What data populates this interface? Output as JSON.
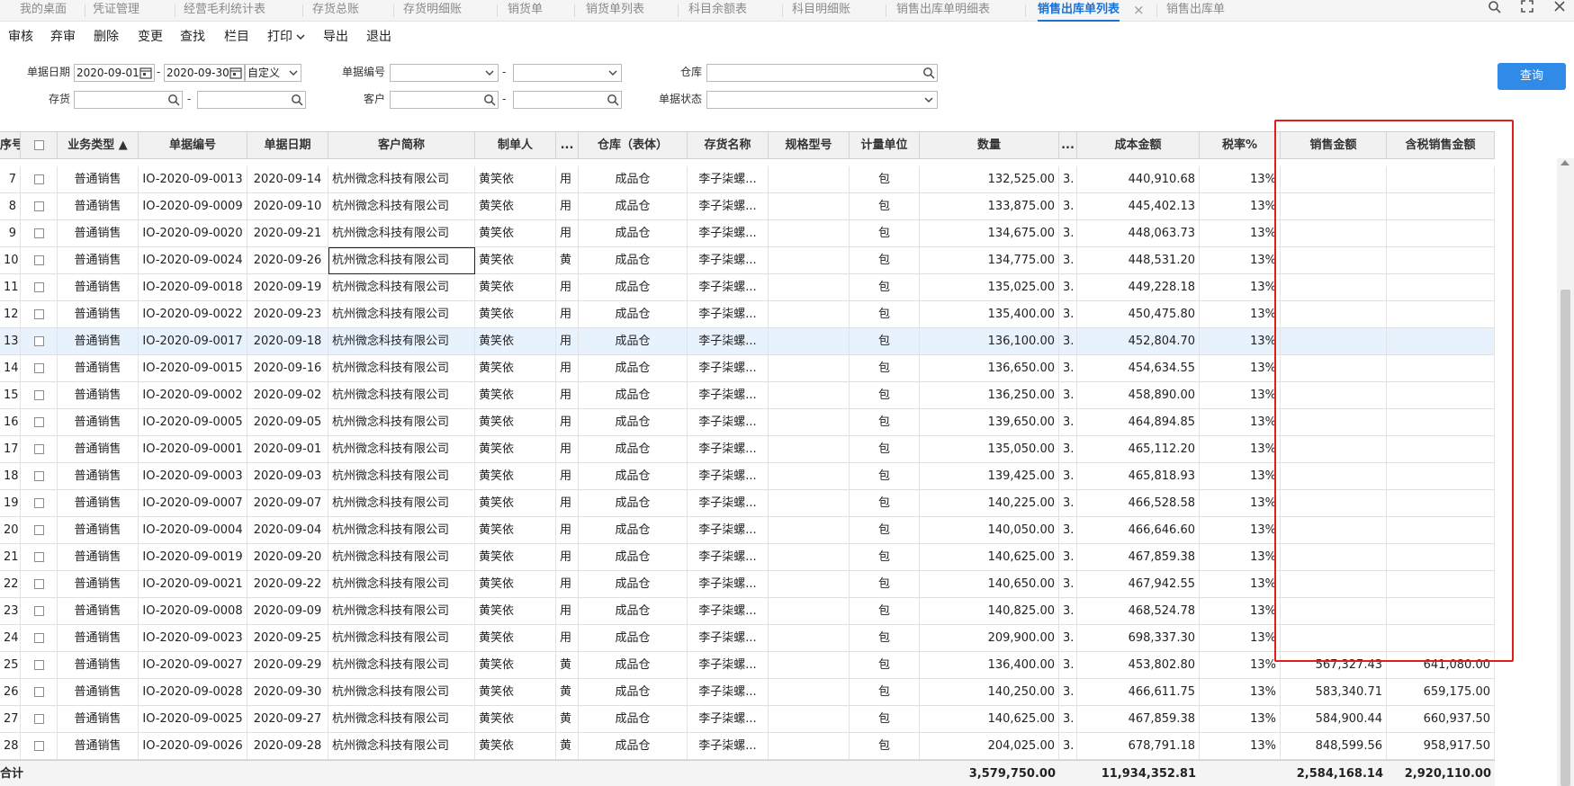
{
  "tabs": [
    {
      "label": "我的桌面",
      "active": false
    },
    {
      "label": "凭证管理",
      "active": false
    },
    {
      "label": "经营毛利统计表",
      "active": false
    },
    {
      "label": "存货总账",
      "active": false
    },
    {
      "label": "存货明细账",
      "active": false
    },
    {
      "label": "销货单",
      "active": false
    },
    {
      "label": "销货单列表",
      "active": false
    },
    {
      "label": "科目余额表",
      "active": false
    },
    {
      "label": "科目明细账",
      "active": false
    },
    {
      "label": "销售出库单明细表",
      "active": false
    },
    {
      "label": "销售出库单列表",
      "active": true
    },
    {
      "label": "销售出库单",
      "active": false
    }
  ],
  "toolbar": {
    "audit": "审核",
    "unaudit": "弃审",
    "delete": "删除",
    "change": "变更",
    "find": "查找",
    "columns": "栏目",
    "print": "打印",
    "export": "导出",
    "exit": "退出"
  },
  "filters": {
    "date_label": "单据日期",
    "date_from": "2020-09-01",
    "date_to": "2020-09-30",
    "date_mode": "自定义",
    "docno_label": "单据编号",
    "docno_from": "",
    "docno_to": "",
    "warehouse_label": "仓库",
    "warehouse": "",
    "inventory_label": "存货",
    "inventory_from": "",
    "inventory_to": "",
    "customer_label": "客户",
    "customer_from": "",
    "customer_to": "",
    "status_label": "单据状态",
    "status": "",
    "dash": "-",
    "query_button": "查询"
  },
  "grid": {
    "headers": {
      "seq": "序号",
      "biz_type": "业务类型 ▲",
      "doc_no": "单据编号",
      "doc_date": "单据日期",
      "customer": "客户简称",
      "maker": "制单人",
      "more1": "...",
      "warehouse": "仓库（表体）",
      "item_name": "存货名称",
      "spec": "规格型号",
      "unit": "计量单位",
      "qty": "数量",
      "more2": "...",
      "cost": "成本金额",
      "tax_rate": "税率%",
      "sales_amt": "销售金额",
      "sales_amt_tax": "含税销售金额"
    },
    "rows": [
      {
        "seq": "7",
        "biz_type": "普通销售",
        "doc_no": "IO-2020-09-0013",
        "doc_date": "2020-09-14",
        "customer": "杭州微念科技有限公司",
        "maker": "黄笑依",
        "more1": "用",
        "warehouse": "成品仓",
        "item_name": "李子柒螺...",
        "spec": "",
        "unit": "包",
        "qty": "132,525.00",
        "more2": "3.",
        "cost": "440,910.68",
        "tax_rate": "13%",
        "sales_amt": "",
        "sales_amt_tax": ""
      },
      {
        "seq": "8",
        "biz_type": "普通销售",
        "doc_no": "IO-2020-09-0009",
        "doc_date": "2020-09-10",
        "customer": "杭州微念科技有限公司",
        "maker": "黄笑依",
        "more1": "用",
        "warehouse": "成品仓",
        "item_name": "李子柒螺...",
        "spec": "",
        "unit": "包",
        "qty": "133,875.00",
        "more2": "3.",
        "cost": "445,402.13",
        "tax_rate": "13%",
        "sales_amt": "",
        "sales_amt_tax": ""
      },
      {
        "seq": "9",
        "biz_type": "普通销售",
        "doc_no": "IO-2020-09-0020",
        "doc_date": "2020-09-21",
        "customer": "杭州微念科技有限公司",
        "maker": "黄笑依",
        "more1": "用",
        "warehouse": "成品仓",
        "item_name": "李子柒螺...",
        "spec": "",
        "unit": "包",
        "qty": "134,675.00",
        "more2": "3.",
        "cost": "448,063.73",
        "tax_rate": "13%",
        "sales_amt": "",
        "sales_amt_tax": ""
      },
      {
        "seq": "10",
        "biz_type": "普通销售",
        "doc_no": "IO-2020-09-0024",
        "doc_date": "2020-09-26",
        "customer": "杭州微念科技有限公司",
        "maker": "黄笑依",
        "more1": "黄",
        "warehouse": "成品仓",
        "item_name": "李子柒螺...",
        "spec": "",
        "unit": "包",
        "qty": "134,775.00",
        "more2": "3.",
        "cost": "448,531.20",
        "tax_rate": "13%",
        "sales_amt": "",
        "sales_amt_tax": ""
      },
      {
        "seq": "11",
        "biz_type": "普通销售",
        "doc_no": "IO-2020-09-0018",
        "doc_date": "2020-09-19",
        "customer": "杭州微念科技有限公司",
        "maker": "黄笑依",
        "more1": "用",
        "warehouse": "成品仓",
        "item_name": "李子柒螺...",
        "spec": "",
        "unit": "包",
        "qty": "135,025.00",
        "more2": "3.",
        "cost": "449,228.18",
        "tax_rate": "13%",
        "sales_amt": "",
        "sales_amt_tax": ""
      },
      {
        "seq": "12",
        "biz_type": "普通销售",
        "doc_no": "IO-2020-09-0022",
        "doc_date": "2020-09-23",
        "customer": "杭州微念科技有限公司",
        "maker": "黄笑依",
        "more1": "用",
        "warehouse": "成品仓",
        "item_name": "李子柒螺...",
        "spec": "",
        "unit": "包",
        "qty": "135,400.00",
        "more2": "3.",
        "cost": "450,475.80",
        "tax_rate": "13%",
        "sales_amt": "",
        "sales_amt_tax": ""
      },
      {
        "seq": "13",
        "biz_type": "普通销售",
        "doc_no": "IO-2020-09-0017",
        "doc_date": "2020-09-18",
        "customer": "杭州微念科技有限公司",
        "maker": "黄笑依",
        "more1": "用",
        "warehouse": "成品仓",
        "item_name": "李子柒螺...",
        "spec": "",
        "unit": "包",
        "qty": "136,100.00",
        "more2": "3.",
        "cost": "452,804.70",
        "tax_rate": "13%",
        "sales_amt": "",
        "sales_amt_tax": ""
      },
      {
        "seq": "14",
        "biz_type": "普通销售",
        "doc_no": "IO-2020-09-0015",
        "doc_date": "2020-09-16",
        "customer": "杭州微念科技有限公司",
        "maker": "黄笑依",
        "more1": "用",
        "warehouse": "成品仓",
        "item_name": "李子柒螺...",
        "spec": "",
        "unit": "包",
        "qty": "136,650.00",
        "more2": "3.",
        "cost": "454,634.55",
        "tax_rate": "13%",
        "sales_amt": "",
        "sales_amt_tax": ""
      },
      {
        "seq": "15",
        "biz_type": "普通销售",
        "doc_no": "IO-2020-09-0002",
        "doc_date": "2020-09-02",
        "customer": "杭州微念科技有限公司",
        "maker": "黄笑依",
        "more1": "用",
        "warehouse": "成品仓",
        "item_name": "李子柒螺...",
        "spec": "",
        "unit": "包",
        "qty": "136,250.00",
        "more2": "3.",
        "cost": "458,890.00",
        "tax_rate": "13%",
        "sales_amt": "",
        "sales_amt_tax": ""
      },
      {
        "seq": "16",
        "biz_type": "普通销售",
        "doc_no": "IO-2020-09-0005",
        "doc_date": "2020-09-05",
        "customer": "杭州微念科技有限公司",
        "maker": "黄笑依",
        "more1": "用",
        "warehouse": "成品仓",
        "item_name": "李子柒螺...",
        "spec": "",
        "unit": "包",
        "qty": "139,650.00",
        "more2": "3.",
        "cost": "464,894.85",
        "tax_rate": "13%",
        "sales_amt": "",
        "sales_amt_tax": ""
      },
      {
        "seq": "17",
        "biz_type": "普通销售",
        "doc_no": "IO-2020-09-0001",
        "doc_date": "2020-09-01",
        "customer": "杭州微念科技有限公司",
        "maker": "黄笑依",
        "more1": "用",
        "warehouse": "成品仓",
        "item_name": "李子柒螺...",
        "spec": "",
        "unit": "包",
        "qty": "135,050.00",
        "more2": "3.",
        "cost": "465,112.20",
        "tax_rate": "13%",
        "sales_amt": "",
        "sales_amt_tax": ""
      },
      {
        "seq": "18",
        "biz_type": "普通销售",
        "doc_no": "IO-2020-09-0003",
        "doc_date": "2020-09-03",
        "customer": "杭州微念科技有限公司",
        "maker": "黄笑依",
        "more1": "用",
        "warehouse": "成品仓",
        "item_name": "李子柒螺...",
        "spec": "",
        "unit": "包",
        "qty": "139,425.00",
        "more2": "3.",
        "cost": "465,818.93",
        "tax_rate": "13%",
        "sales_amt": "",
        "sales_amt_tax": ""
      },
      {
        "seq": "19",
        "biz_type": "普通销售",
        "doc_no": "IO-2020-09-0007",
        "doc_date": "2020-09-07",
        "customer": "杭州微念科技有限公司",
        "maker": "黄笑依",
        "more1": "用",
        "warehouse": "成品仓",
        "item_name": "李子柒螺...",
        "spec": "",
        "unit": "包",
        "qty": "140,225.00",
        "more2": "3.",
        "cost": "466,528.58",
        "tax_rate": "13%",
        "sales_amt": "",
        "sales_amt_tax": ""
      },
      {
        "seq": "20",
        "biz_type": "普通销售",
        "doc_no": "IO-2020-09-0004",
        "doc_date": "2020-09-04",
        "customer": "杭州微念科技有限公司",
        "maker": "黄笑依",
        "more1": "用",
        "warehouse": "成品仓",
        "item_name": "李子柒螺...",
        "spec": "",
        "unit": "包",
        "qty": "140,050.00",
        "more2": "3.",
        "cost": "466,646.60",
        "tax_rate": "13%",
        "sales_amt": "",
        "sales_amt_tax": ""
      },
      {
        "seq": "21",
        "biz_type": "普通销售",
        "doc_no": "IO-2020-09-0019",
        "doc_date": "2020-09-20",
        "customer": "杭州微念科技有限公司",
        "maker": "黄笑依",
        "more1": "用",
        "warehouse": "成品仓",
        "item_name": "李子柒螺...",
        "spec": "",
        "unit": "包",
        "qty": "140,625.00",
        "more2": "3.",
        "cost": "467,859.38",
        "tax_rate": "13%",
        "sales_amt": "",
        "sales_amt_tax": ""
      },
      {
        "seq": "22",
        "biz_type": "普通销售",
        "doc_no": "IO-2020-09-0021",
        "doc_date": "2020-09-22",
        "customer": "杭州微念科技有限公司",
        "maker": "黄笑依",
        "more1": "用",
        "warehouse": "成品仓",
        "item_name": "李子柒螺...",
        "spec": "",
        "unit": "包",
        "qty": "140,650.00",
        "more2": "3.",
        "cost": "467,942.55",
        "tax_rate": "13%",
        "sales_amt": "",
        "sales_amt_tax": ""
      },
      {
        "seq": "23",
        "biz_type": "普通销售",
        "doc_no": "IO-2020-09-0008",
        "doc_date": "2020-09-09",
        "customer": "杭州微念科技有限公司",
        "maker": "黄笑依",
        "more1": "用",
        "warehouse": "成品仓",
        "item_name": "李子柒螺...",
        "spec": "",
        "unit": "包",
        "qty": "140,825.00",
        "more2": "3.",
        "cost": "468,524.78",
        "tax_rate": "13%",
        "sales_amt": "",
        "sales_amt_tax": ""
      },
      {
        "seq": "24",
        "biz_type": "普通销售",
        "doc_no": "IO-2020-09-0023",
        "doc_date": "2020-09-25",
        "customer": "杭州微念科技有限公司",
        "maker": "黄笑依",
        "more1": "用",
        "warehouse": "成品仓",
        "item_name": "李子柒螺...",
        "spec": "",
        "unit": "包",
        "qty": "209,900.00",
        "more2": "3.",
        "cost": "698,337.30",
        "tax_rate": "13%",
        "sales_amt": "",
        "sales_amt_tax": ""
      },
      {
        "seq": "25",
        "biz_type": "普通销售",
        "doc_no": "IO-2020-09-0027",
        "doc_date": "2020-09-29",
        "customer": "杭州微念科技有限公司",
        "maker": "黄笑依",
        "more1": "黄",
        "warehouse": "成品仓",
        "item_name": "李子柒螺...",
        "spec": "",
        "unit": "包",
        "qty": "136,400.00",
        "more2": "3.",
        "cost": "453,802.80",
        "tax_rate": "13%",
        "sales_amt": "567,327.43",
        "sales_amt_tax": "641,080.00"
      },
      {
        "seq": "26",
        "biz_type": "普通销售",
        "doc_no": "IO-2020-09-0028",
        "doc_date": "2020-09-30",
        "customer": "杭州微念科技有限公司",
        "maker": "黄笑依",
        "more1": "黄",
        "warehouse": "成品仓",
        "item_name": "李子柒螺...",
        "spec": "",
        "unit": "包",
        "qty": "140,250.00",
        "more2": "3.",
        "cost": "466,611.75",
        "tax_rate": "13%",
        "sales_amt": "583,340.71",
        "sales_amt_tax": "659,175.00"
      },
      {
        "seq": "27",
        "biz_type": "普通销售",
        "doc_no": "IO-2020-09-0025",
        "doc_date": "2020-09-27",
        "customer": "杭州微念科技有限公司",
        "maker": "黄笑依",
        "more1": "黄",
        "warehouse": "成品仓",
        "item_name": "李子柒螺...",
        "spec": "",
        "unit": "包",
        "qty": "140,625.00",
        "more2": "3.",
        "cost": "467,859.38",
        "tax_rate": "13%",
        "sales_amt": "584,900.44",
        "sales_amt_tax": "660,937.50"
      },
      {
        "seq": "28",
        "biz_type": "普通销售",
        "doc_no": "IO-2020-09-0026",
        "doc_date": "2020-09-28",
        "customer": "杭州微念科技有限公司",
        "maker": "黄笑依",
        "more1": "黄",
        "warehouse": "成品仓",
        "item_name": "李子柒螺...",
        "spec": "",
        "unit": "包",
        "qty": "204,025.00",
        "more2": "3.",
        "cost": "678,791.18",
        "tax_rate": "13%",
        "sales_amt": "848,599.56",
        "sales_amt_tax": "958,917.50"
      }
    ],
    "totals": {
      "label": "合计",
      "qty": "3,579,750.00",
      "cost": "11,934,352.81",
      "sales_amt": "2,584,168.14",
      "sales_amt_tax": "2,920,110.00"
    }
  },
  "colors": {
    "accent": "#1a72d6",
    "query_button": "#2f8ae8",
    "highlight_row": "#e8f2fd",
    "annotation_red": "#e01e1e"
  },
  "icons": [
    "calendar-icon",
    "search-icon",
    "chevron-down-icon",
    "close-icon",
    "minimize-icon",
    "maximize-icon"
  ]
}
